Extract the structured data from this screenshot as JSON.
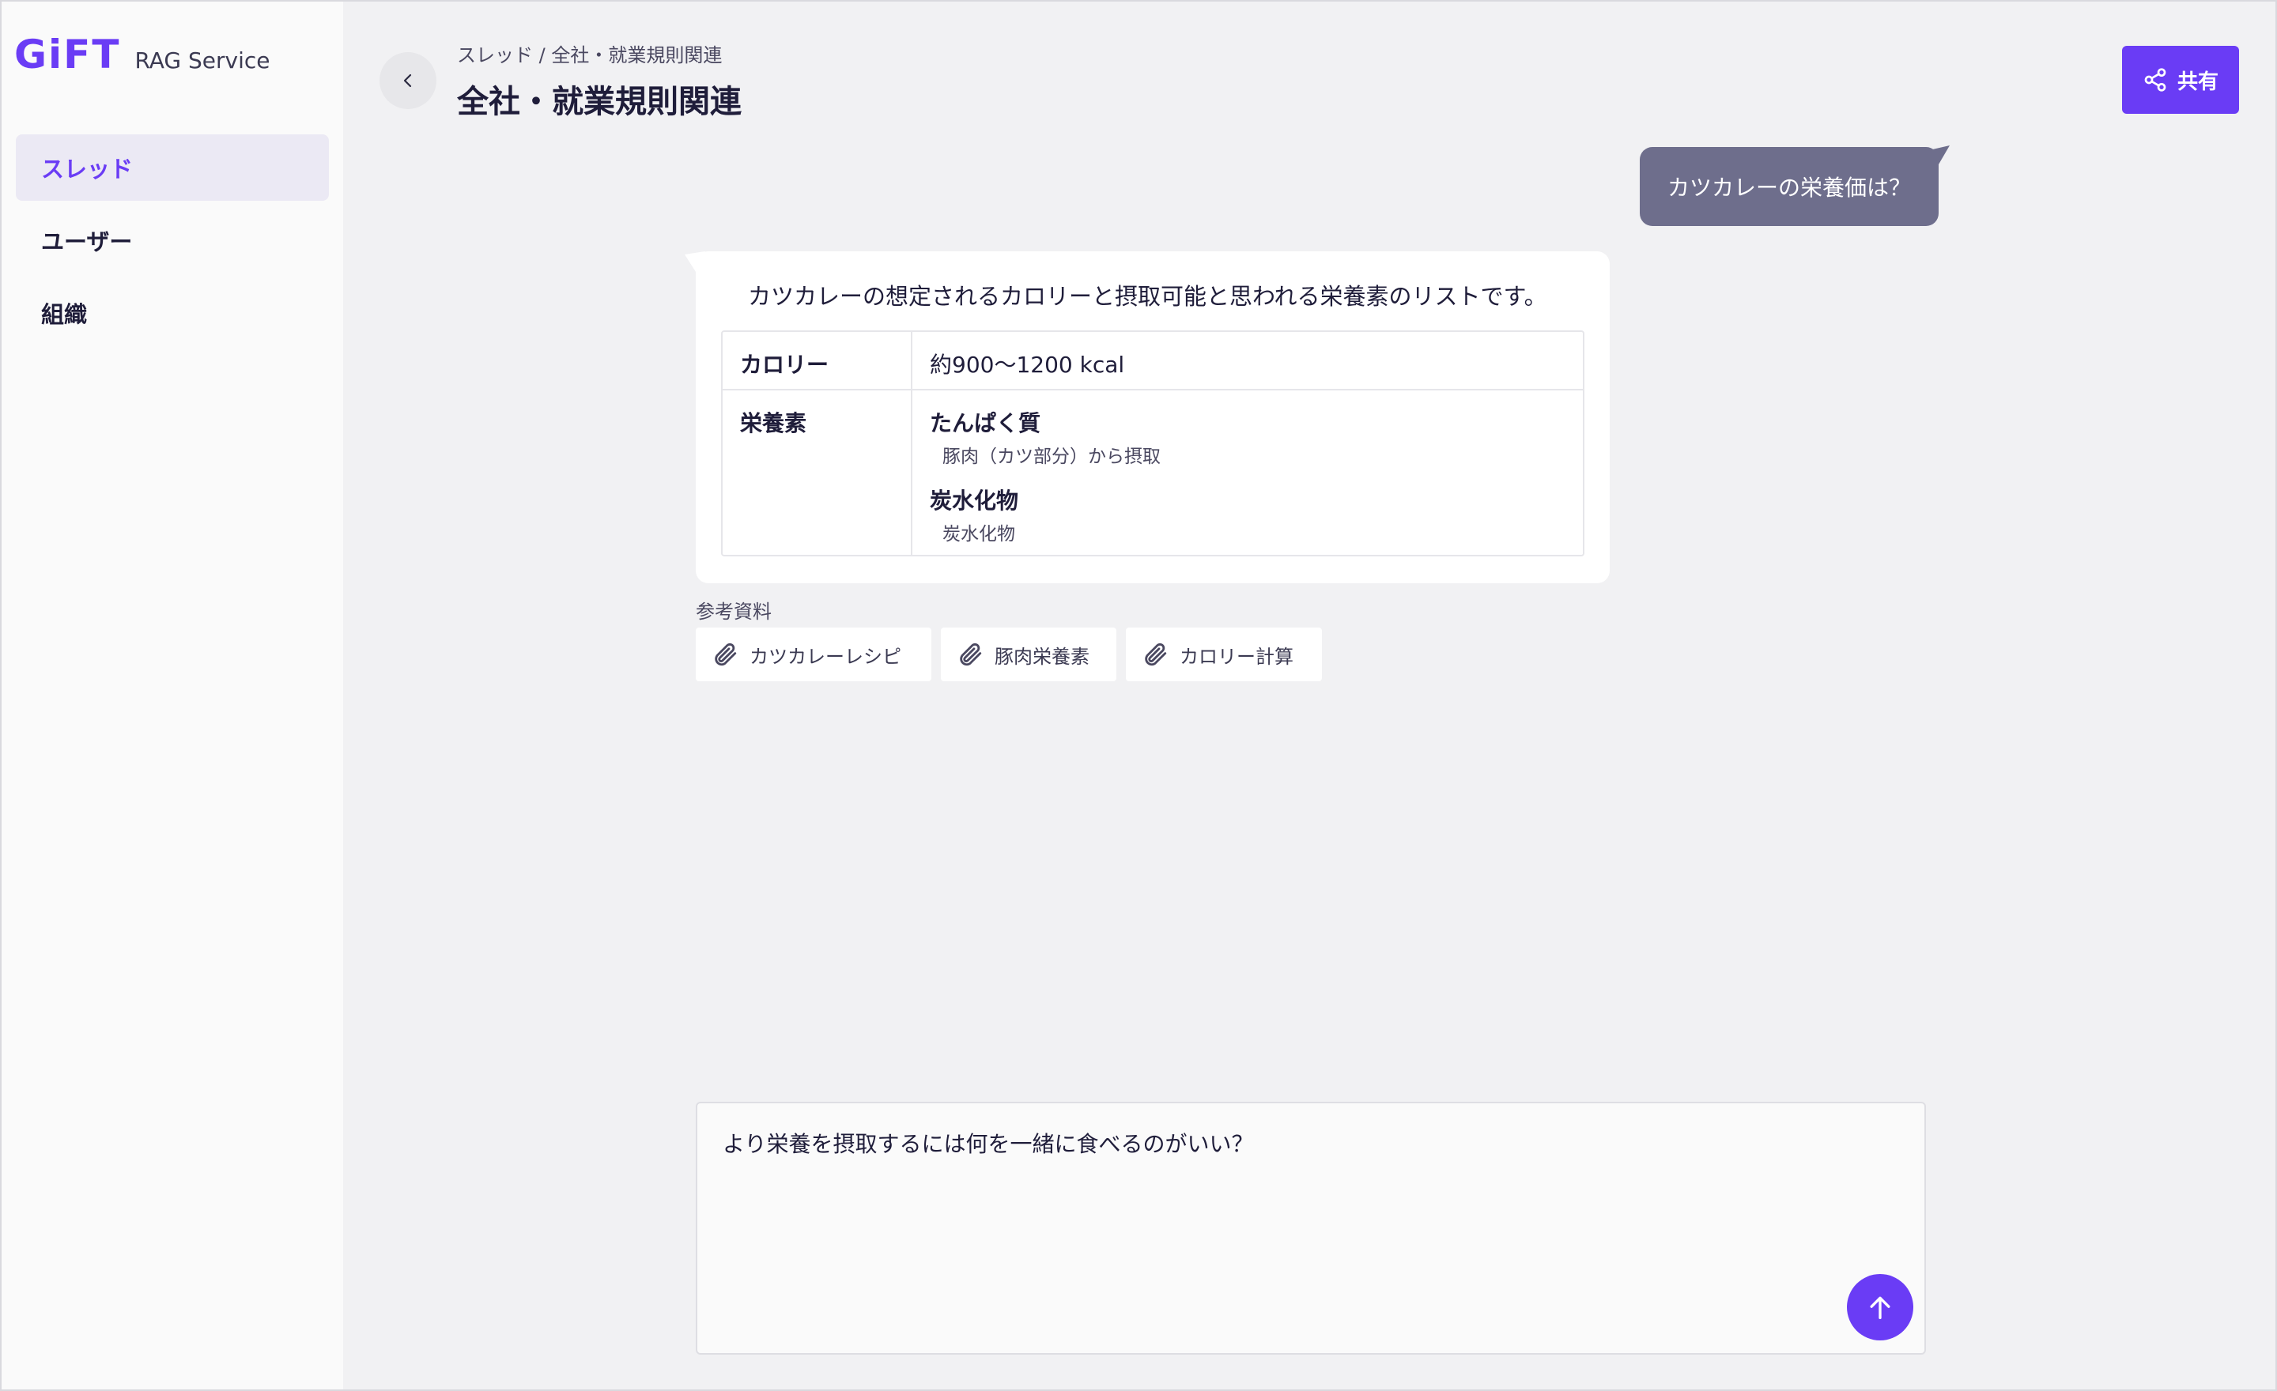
{
  "app": {
    "logo": "GiFT",
    "service_name": "RAG Service"
  },
  "sidebar": {
    "items": [
      {
        "label": "スレッド",
        "active": true
      },
      {
        "label": "ユーザー",
        "active": false
      },
      {
        "label": "組織",
        "active": false
      }
    ]
  },
  "header": {
    "breadcrumb": "スレッド / 全社・就業規則関連",
    "title": "全社・就業規則関連",
    "share_label": "共有"
  },
  "messages": {
    "user_message": "カツカレーの栄養価は？",
    "ai_intro": "カツカレーの想定されるカロリーと摂取可能と思われる栄養素のリストです。",
    "table": {
      "calorie_label": "カロリー",
      "calorie_value": "約900〜1200 kcal",
      "nutrients_label": "栄養素",
      "nutrients": [
        {
          "name": "たんぱく質",
          "desc": "豚肉（カツ部分）から摂取"
        },
        {
          "name": "炭水化物",
          "desc": "炭水化物"
        }
      ]
    }
  },
  "references": {
    "label": "参考資料",
    "items": [
      "カツカレーレシピ",
      "豚肉栄養素",
      "カロリー計算"
    ]
  },
  "composer": {
    "value": "より栄養を摂取するには何を一緒に食べるのがいい？"
  },
  "colors": {
    "accent": "#6a3cf5",
    "user_bubble": "#6e6e8c",
    "background": "#f1f1f3"
  }
}
